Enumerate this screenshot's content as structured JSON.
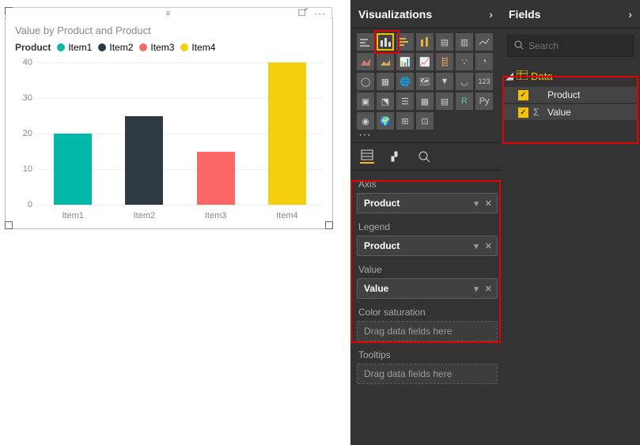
{
  "chart": {
    "title": "Value by Product and Product",
    "legend_label": "Product"
  },
  "chart_data": {
    "type": "bar",
    "categories": [
      "Item1",
      "Item2",
      "Item3",
      "Item4"
    ],
    "series": [
      {
        "name": "Item1",
        "color": "#00b8a5"
      },
      {
        "name": "Item2",
        "color": "#2e3b44"
      },
      {
        "name": "Item3",
        "color": "#fb6667"
      },
      {
        "name": "Item4",
        "color": "#f4cf0e"
      }
    ],
    "values": [
      20,
      25,
      15,
      40
    ],
    "ylim": [
      0,
      40
    ],
    "yticks": [
      0,
      10,
      20,
      30,
      40
    ],
    "title": "Value by Product and Product",
    "xlabel": "",
    "ylabel": ""
  },
  "viz_panel": {
    "title": "Visualizations",
    "wells": {
      "axis": {
        "label": "Axis",
        "value": "Product"
      },
      "legend": {
        "label": "Legend",
        "value": "Product"
      },
      "value": {
        "label": "Value",
        "value": "Value"
      },
      "color_sat": {
        "label": "Color saturation",
        "placeholder": "Drag data fields here"
      },
      "tooltips": {
        "label": "Tooltips",
        "placeholder": "Drag data fields here"
      }
    }
  },
  "fields_panel": {
    "title": "Fields",
    "search_placeholder": "Search",
    "table": "Data",
    "fields": [
      {
        "name": "Product",
        "checked": true,
        "aggregate": false
      },
      {
        "name": "Value",
        "checked": true,
        "aggregate": true
      }
    ]
  }
}
